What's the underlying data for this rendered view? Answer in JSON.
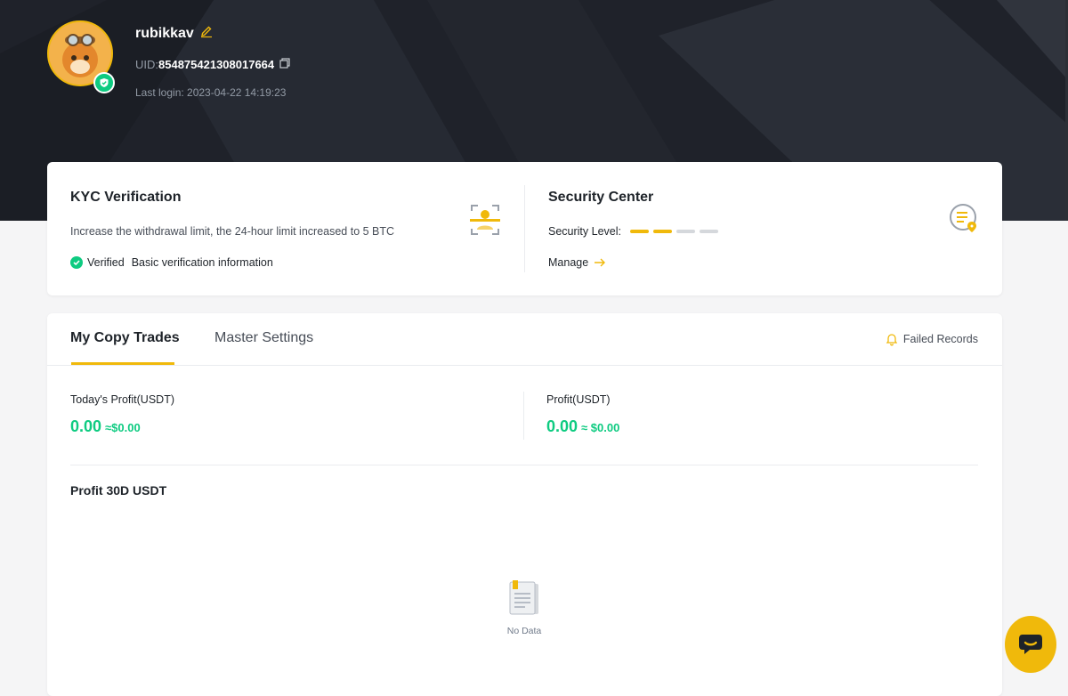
{
  "profile": {
    "username": "rubikkav",
    "uid_label": "UID:",
    "uid_value": "854875421308017664",
    "last_login": "Last login: 2023-04-22 14:19:23"
  },
  "kyc": {
    "title": "KYC Verification",
    "description": "Increase the withdrawal limit, the 24-hour limit increased to 5 BTC",
    "status": "Verified",
    "status_detail": "Basic verification information"
  },
  "security": {
    "title": "Security Center",
    "level_label": "Security Level:",
    "level_filled": 2,
    "level_total": 4,
    "manage_label": "Manage"
  },
  "copy_trades": {
    "tabs": [
      {
        "label": "My Copy Trades",
        "active": true
      },
      {
        "label": "Master Settings",
        "active": false
      }
    ],
    "failed_records_label": "Failed Records",
    "todays_profit_label": "Today's Profit(USDT)",
    "todays_profit_value": "0.00",
    "todays_profit_usd": "≈$0.00",
    "profit_label": "Profit(USDT)",
    "profit_value": "0.00",
    "profit_usd": "≈ $0.00",
    "profit_30d_label": "Profit 30D USDT",
    "no_data_label": "No Data"
  },
  "colors": {
    "accent": "#f0b90b",
    "positive": "#0ecb81",
    "hero_bg": "#1f222a"
  },
  "icons": [
    "edit-icon",
    "copy-icon",
    "shield-check-icon",
    "face-scan-icon",
    "security-list-icon",
    "arrow-right-icon",
    "bell-icon",
    "empty-document-icon",
    "chat-icon"
  ]
}
